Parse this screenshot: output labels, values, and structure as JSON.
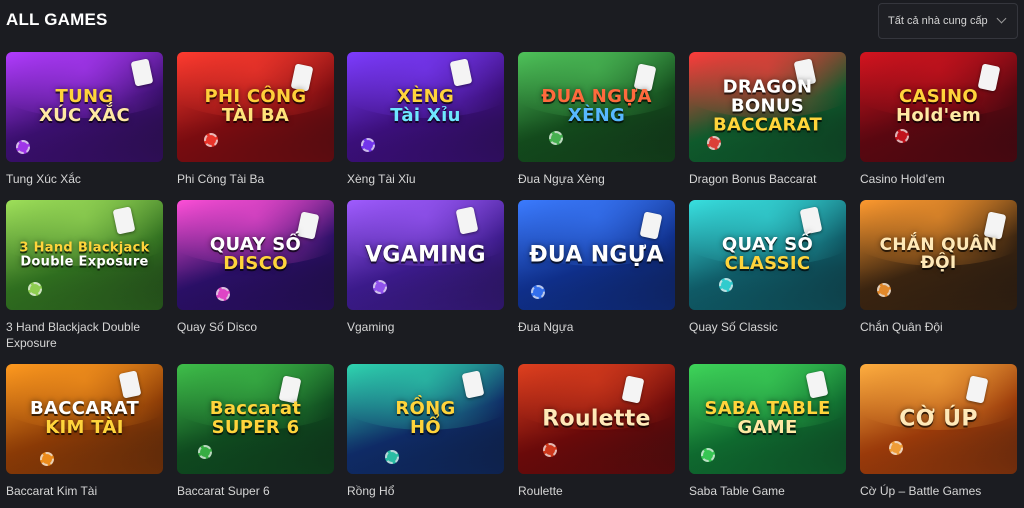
{
  "header": {
    "title": "ALL GAMES",
    "provider_select": {
      "value": "Tất cả nhà cung cấp"
    }
  },
  "games": [
    {
      "name": "Tung Xúc Xắc",
      "logo": [
        "TUNG",
        "XÚC XẮC"
      ],
      "bg": "#3a0f6e",
      "accent": "#b23cff",
      "text": "#ffd43b",
      "text2": "#ffe9a3"
    },
    {
      "name": "Phi Công Tài Ba",
      "logo": [
        "PHI CÔNG",
        "TÀI BA"
      ],
      "bg": "#7a0c10",
      "accent": "#ff3b2f",
      "text": "#ffcf3a",
      "text2": "#ffe37a"
    },
    {
      "name": "Xèng Tài Xỉu",
      "logo": [
        "XÈNG",
        "Tài Xỉu"
      ],
      "bg": "#3b0f7a",
      "accent": "#7d3cff",
      "text": "#ffd43b",
      "text2": "#6ee7ff"
    },
    {
      "name": "Đua Ngựa Xèng",
      "logo": [
        "ĐUA NGỰA",
        "XÈNG"
      ],
      "bg": "#134a1c",
      "accent": "#4fc35a",
      "text": "#ff6a3d",
      "text2": "#57b8ff"
    },
    {
      "name": "Dragon Bonus Baccarat",
      "logo": [
        "DRAGON BONUS",
        "BACCARAT"
      ],
      "bg": "#0f5a2c",
      "accent": "#ff3b3b",
      "text": "#ffffff",
      "text2": "#ffd43b"
    },
    {
      "name": "Casino Hold’em",
      "logo": [
        "CASINO",
        "Hold'em"
      ],
      "bg": "#5a0710",
      "accent": "#d4141f",
      "text": "#ffd43b",
      "text2": "#ffe9a3"
    },
    {
      "name": "3 Hand Blackjack Double Exposure",
      "logo": [
        "3 Hand Blackjack",
        "Double Exposure"
      ],
      "bg": "#2f6e1f",
      "accent": "#9fe05a",
      "text": "#ffd43b",
      "text2": "#ffffff"
    },
    {
      "name": "Quay Số Disco",
      "logo": [
        "QUAY SỐ",
        "DISCO"
      ],
      "bg": "#2a0f66",
      "accent": "#ff4fd8",
      "text": "#ffffff",
      "text2": "#ffd43b"
    },
    {
      "name": "Vgaming",
      "logo": [
        "VGAMING"
      ],
      "bg": "#3b1a8a",
      "accent": "#a05cff",
      "text": "#ffffff",
      "text2": "#ffffff"
    },
    {
      "name": "Đua Ngựa",
      "logo": [
        "ĐUA NGỰA"
      ],
      "bg": "#0f2f8a",
      "accent": "#3b7bff",
      "text": "#ffffff",
      "text2": "#ffffff"
    },
    {
      "name": "Quay Số Classic",
      "logo": [
        "QUAY SỐ",
        "CLASSIC"
      ],
      "bg": "#0f5a66",
      "accent": "#38e0e0",
      "text": "#ffffff",
      "text2": "#ffd43b"
    },
    {
      "name": "Chắn Quân Đội",
      "logo": [
        "CHẮN QUÂN ĐỘI"
      ],
      "bg": "#3a2410",
      "accent": "#ff9a2f",
      "text": "#ffe9b8",
      "text2": "#ffe9b8"
    },
    {
      "name": "Baccarat Kim Tài",
      "logo": [
        "BACCARAT",
        "KIM TÀI"
      ],
      "bg": "#8a3a06",
      "accent": "#ff9a1f",
      "text": "#ffffff",
      "text2": "#ffd43b"
    },
    {
      "name": "Baccarat Super 6",
      "logo": [
        "Baccarat",
        "SUPER 6"
      ],
      "bg": "#0f4a1f",
      "accent": "#3fbf4a",
      "text": "#ffd43b",
      "text2": "#ffd43b"
    },
    {
      "name": "Rồng Hổ",
      "logo": [
        "RỒNG",
        "HỔ"
      ],
      "bg": "#0f2b66",
      "accent": "#2fd6b0",
      "text": "#ffd43b",
      "text2": "#ffd43b"
    },
    {
      "name": "Roulette",
      "logo": [
        "Roulette"
      ],
      "bg": "#6a0a0a",
      "accent": "#e0401f",
      "text": "#ffe9b8",
      "text2": "#ffe9b8"
    },
    {
      "name": "Saba Table Game",
      "logo": [
        "SABA TABLE",
        "GAME"
      ],
      "bg": "#0f6a2f",
      "accent": "#3fd65a",
      "text": "#ffd43b",
      "text2": "#ffe9a3"
    },
    {
      "name": "Cờ Úp – Battle Games",
      "logo": [
        "CỜ ÚP"
      ],
      "bg": "#9a3a0a",
      "accent": "#ffae3f",
      "text": "#ffe9b8",
      "text2": "#ffe9b8"
    }
  ]
}
